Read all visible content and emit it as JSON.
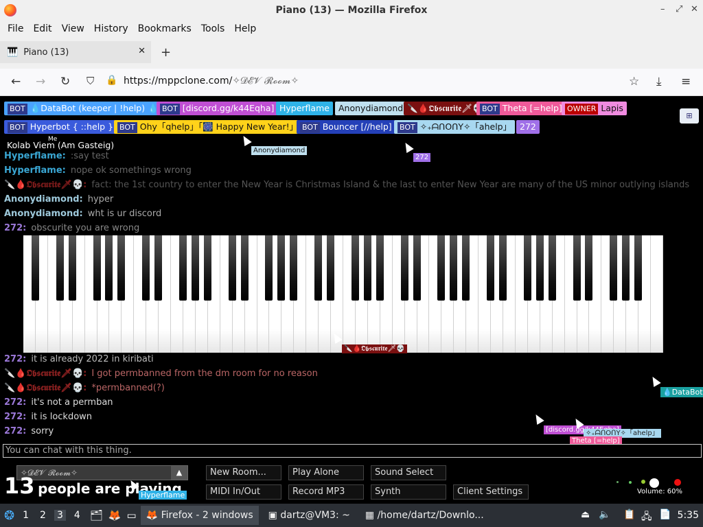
{
  "window": {
    "title": "Piano (13) — Mozilla Firefox"
  },
  "menu": [
    "File",
    "Edit",
    "View",
    "History",
    "Bookmarks",
    "Tools",
    "Help"
  ],
  "tab": {
    "title": "Piano (13)"
  },
  "urlbar": {
    "host": "https://mppclone.com/",
    "path": "✧𝓓𝓔𝓥 𝓡𝓸𝓸𝓶✧"
  },
  "badges": {
    "row1": [
      {
        "tag": "BOT",
        "label": "💧DataBot (keeper | !help) 💧",
        "color": "#4aa3ff"
      },
      {
        "tag": "BOT",
        "label": "[discord.gg/k44Eqha]",
        "color": "#c04fd4"
      },
      {
        "tag": "",
        "label": "Hyperflame",
        "color": "#2fb3e8"
      },
      {
        "tag": "",
        "label": "Anonydiamond",
        "color": "#bfe0ef"
      },
      {
        "tag": "",
        "label": "🔪🩸𝕺𝖇𝖘𝖈𝖚𝖗𝖎𝖙𝖊🗡💀",
        "color": "#7a1010"
      },
      {
        "tag": "BOT",
        "label": "Theta [=help]",
        "color": "#f05a9a"
      },
      {
        "tag": "OWNER",
        "label": "Lapis",
        "color": "#f08be0"
      }
    ],
    "row2": [
      {
        "tag": "BOT",
        "label": "Hyperbot { ::help }",
        "color": "#3a5bdc"
      },
      {
        "tag": "BOT",
        "label": "Ohy「qhelp」「🎆 Happy New Year!」",
        "color": "#ffd21a"
      },
      {
        "tag": "BOT",
        "label": "Bouncer [//help]",
        "color": "#2440b8"
      },
      {
        "tag": "BOT",
        "label": "✧₊ᗩᑎOᑎY✧「ahelp」",
        "color": "#a8d8f0"
      },
      {
        "tag": "",
        "label": "272",
        "color": "#a070e8"
      }
    ]
  },
  "labels": {
    "kolab": "Kolab Viem (Am Gasteig)",
    "me": "Me"
  },
  "chat": [
    {
      "nick": "Hyperflame:",
      "msg": ":say test",
      "nick_color": "#3aa7d4",
      "msg_color": "#666"
    },
    {
      "nick": "Hyperflame:",
      "msg": "nope ok somethings wrong",
      "nick_color": "#3aa7d4",
      "msg_color": "#666"
    },
    {
      "nick": "🔪🩸𝕺𝖇𝖘𝖈𝖚𝖗𝖎𝖙𝖊🗡💀:",
      "msg": "fact: the 1st country to enter the New Year is Christmas Island & the last to enter New Year are many of the US minor outlying islands",
      "nick_color": "#7a1a1a",
      "msg_color": "#555"
    },
    {
      "nick": "Anonydiamond:",
      "msg": "hyper",
      "nick_color": "#9ec9db",
      "msg_color": "#aaa"
    },
    {
      "nick": "Anonydiamond:",
      "msg": "wht is ur discord",
      "nick_color": "#9ec9db",
      "msg_color": "#aaa"
    },
    {
      "nick": "272:",
      "msg": "obscurite you are wrong",
      "nick_color": "#9b78d8",
      "msg_color": "#888"
    }
  ],
  "chat_lower": [
    {
      "nick": "272:",
      "msg": "it is already 2022 in kiribati",
      "nick_color": "#9b78d8",
      "msg_color": "#bbb"
    },
    {
      "nick": "🔪🩸𝕺𝖇𝖘𝖈𝖚𝖗𝖎𝖙𝖊🗡💀:",
      "msg": "I got permbanned from the dm room for no reason",
      "nick_color": "#8a2020",
      "msg_color": "#bb6666"
    },
    {
      "nick": "🔪🩸𝕺𝖇𝖘𝖈𝖚𝖗𝖎𝖙𝖊🗡💀:",
      "msg": "*permbanned(?)",
      "nick_color": "#8a2020",
      "msg_color": "#bb6666"
    },
    {
      "nick": "272:",
      "msg": "it's not a permban",
      "nick_color": "#9b78d8",
      "msg_color": "#ddd"
    },
    {
      "nick": "272:",
      "msg": "it is lockdown",
      "nick_color": "#9b78d8",
      "msg_color": "#ddd"
    },
    {
      "nick": "272:",
      "msg": "sorry",
      "nick_color": "#9b78d8",
      "msg_color": "#ddd"
    }
  ],
  "cursors": {
    "anony": "Anonydiamond",
    "n272": "272",
    "obscurite": "🔪🩸𝕺𝖇𝖘𝖈𝖚𝖗𝖎𝖙𝖊🗡💀",
    "databot": "💧DataBot",
    "discord": "[discord.gg/k44Eqha]",
    "anony2": "✧₊ᗩᑎOᑎY✧「ahelp」",
    "theta": "Theta [=help]",
    "hyperflame": "Hyperflame"
  },
  "chat_input": {
    "placeholder": "You can chat with this thing."
  },
  "room_select": {
    "value": "✧𝓓𝓔𝓥 𝓡𝓸𝓸𝓶✧"
  },
  "buttons": {
    "new_room": "New Room...",
    "play_alone": "Play Alone",
    "sound_select": "Sound Select",
    "midi": "MIDI In/Out",
    "record": "Record MP3",
    "synth": "Synth",
    "client_settings": "Client Settings"
  },
  "people": {
    "count": "13",
    "text": "people are playing"
  },
  "volume": {
    "label": "Volume: 60%"
  },
  "taskbar": {
    "workspaces": [
      "1",
      "2",
      "3",
      "4"
    ],
    "firefox": "Firefox - 2 windows",
    "terminal": "dartz@VM3: ~",
    "files": "/home/dartz/Downlo...",
    "clock": "5:35"
  }
}
